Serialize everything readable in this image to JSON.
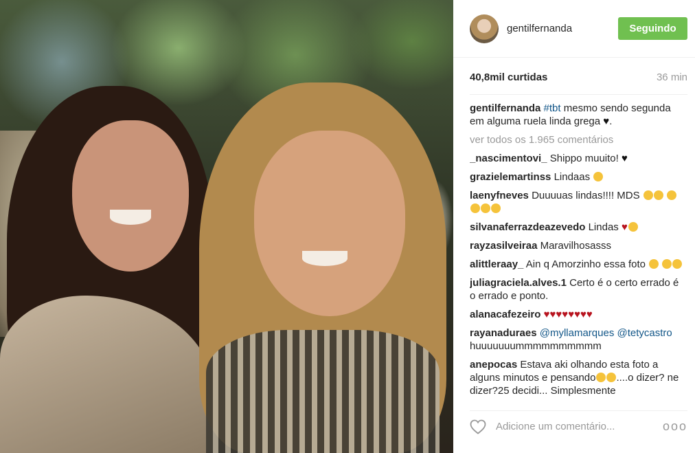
{
  "header": {
    "username": "gentilfernanda",
    "follow_label": "Seguindo"
  },
  "stats": {
    "likes": "40,8mil curtidas",
    "time": "36 min"
  },
  "caption": {
    "user": "gentilfernanda",
    "hashtag": "#tbt",
    "text": "mesmo sendo segunda em alguma ruela linda grega"
  },
  "view_all": "ver todos os 1.965 comentários",
  "comments": [
    {
      "user": "_nascimentovi_",
      "text": "Shippo muuito!"
    },
    {
      "user": "grazielemartinss",
      "text": "Lindaas"
    },
    {
      "user": "laenyfneves",
      "text": "Duuuuas lindas!!!! MDS"
    },
    {
      "user": "silvanaferrazdeazevedo",
      "text": "Lindas"
    },
    {
      "user": "rayzasilveiraa",
      "text": "Maravilhosasss"
    },
    {
      "user": "alittleraay_",
      "text": "Ain q Amorzinho essa foto"
    },
    {
      "user": "juliagraciela.alves.1",
      "text": "Certo é o certo errado é o errado e ponto."
    },
    {
      "user": "alanacafezeiro",
      "text": ""
    },
    {
      "user": "rayanaduraes",
      "mention1": "@myllamarques",
      "mention2": "@tetycastro",
      "text": "huuuuuuummmmmmmmmm"
    },
    {
      "user": "anepocas",
      "text": "Estava aki olhando esta foto a alguns minutos e pensando",
      "text2": "....o dizer? ne dizer?25 decidi... Simplesmente"
    }
  ],
  "footer": {
    "comment_placeholder": "Adicione um comentário...",
    "more_label": "ooo"
  },
  "icons": {
    "heart": "heart-outline-icon",
    "more": "more-options-icon"
  },
  "colors": {
    "follow_button": "#70c050",
    "mention": "#125688",
    "muted": "#999999"
  }
}
